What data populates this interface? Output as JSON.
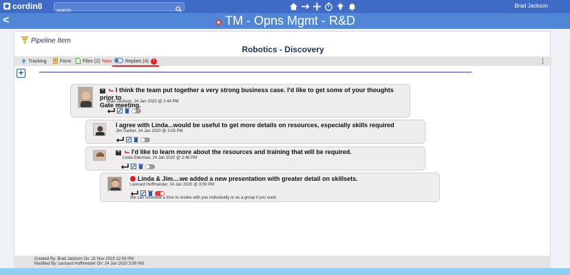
{
  "app": {
    "brand": "cordin8",
    "search_placeholder": "search",
    "user_name": "Brad Jackson",
    "title": "TM - Opns Mgmt - R&D",
    "back_label": "<",
    "accent": "#3f6bc6"
  },
  "toolbar": {
    "icons": [
      "home-icon",
      "arrow-right-icon",
      "plus-icon",
      "timer-icon",
      "lightbulb-icon",
      "bell-icon"
    ]
  },
  "panel": {
    "header": "Pipeline Item",
    "item_title": "Robotics - Discovery",
    "menu_glyph": "⋮",
    "add_glyph": "+"
  },
  "tabs": [
    {
      "label": "Tracking",
      "icon": "map-pin-icon"
    },
    {
      "label": "Form",
      "icon": "form-icon"
    },
    {
      "label": "Files (2)",
      "badge_text": "New",
      "icon": "file-icon"
    },
    {
      "label": "Replies (4)",
      "badge_count": "1",
      "icon": "toggle-icon",
      "active": true
    }
  ],
  "replies": [
    {
      "heading_line1": "I think the team put together a very strong business case. I'd like to get some of your thoughts prior to",
      "heading_line2": "Gate meeting.",
      "meta": "Brad Jackson, 24 Jan 2020 @ 2:44 PM",
      "collapse": "−"
    },
    {
      "heading_line1": "I agree with Linda...would be useful to get more details on resources, especially skills required",
      "meta": "Jim Gerber, 24 Jan 2020 @ 3:05 PM"
    },
    {
      "heading_line1": "I'd like to learn more about the resources and training that will be required.",
      "meta": "Linda Ellerman, 24 Jan 2020 @ 2:46 PM",
      "collapse": "−"
    },
    {
      "heading_line1": "Linda & Jim....we added a new presentation with greater detail on skillsets.",
      "meta": "Leonard Hoffmeister, 24 Jan 2020 @ 3:09 PM",
      "body": "We can schedule a time to review with you individually or as a group if you want."
    }
  ],
  "footer": {
    "created": "Created By: Brad Jackson On: 21 Nov 2019 12:09 PM",
    "modified": "Modified By: Leonard Hoffmeister On: 24 Jan 2020 3:09 PM"
  }
}
